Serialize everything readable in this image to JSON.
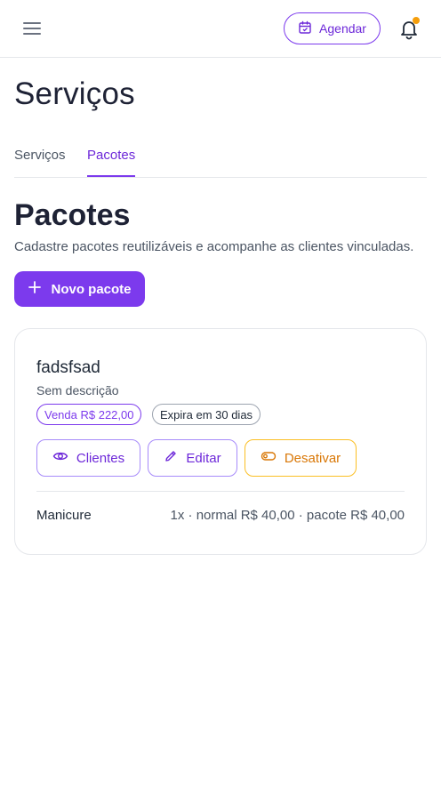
{
  "header": {
    "menu_icon": "hamburger-menu-icon",
    "agendar_label": "Agendar",
    "agendar_icon": "calendar-icon",
    "notification_icon": "bell-icon",
    "notification_dot_color": "#f59e0b"
  },
  "page": {
    "title": "Serviços"
  },
  "tabs": [
    {
      "label": "Serviços",
      "active": false
    },
    {
      "label": "Pacotes",
      "active": true
    }
  ],
  "section": {
    "title": "Pacotes",
    "description": "Cadastre pacotes reutilizáveis e acompanhe as clientes vinculadas.",
    "new_button_label": "Novo pacote",
    "new_button_icon": "plus-icon"
  },
  "package": {
    "name": "fadsfsad",
    "description": "Sem descrição",
    "badges": {
      "venda": "Venda R$ 222,00",
      "expira": "Expira em 30 dias"
    },
    "actions": {
      "clientes": "Clientes",
      "editar": "Editar",
      "desativar": "Desativar"
    },
    "services": [
      {
        "name": "Manicure",
        "detail": "1x · normal R$ 40,00 · pacote R$ 40,00"
      }
    ]
  },
  "colors": {
    "accent": "#7c3aed",
    "warning": "#f59e0b"
  }
}
